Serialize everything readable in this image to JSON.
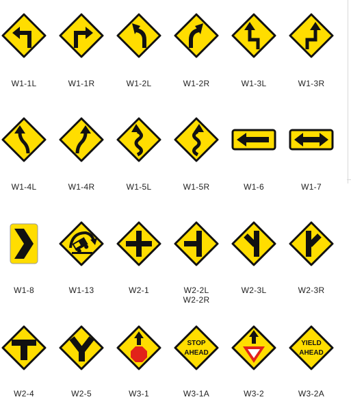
{
  "signs": [
    {
      "code": "W1-1L",
      "icon": "turn-left-icon"
    },
    {
      "code": "W1-1R",
      "icon": "turn-right-icon"
    },
    {
      "code": "W1-2L",
      "icon": "curve-left-icon"
    },
    {
      "code": "W1-2R",
      "icon": "curve-right-icon"
    },
    {
      "code": "W1-3L",
      "icon": "reverse-turn-left-icon"
    },
    {
      "code": "W1-3R",
      "icon": "reverse-turn-right-icon"
    },
    {
      "code": "W1-4L",
      "icon": "reverse-curve-left-icon"
    },
    {
      "code": "W1-4R",
      "icon": "reverse-curve-right-icon"
    },
    {
      "code": "W1-5L",
      "icon": "winding-road-left-icon"
    },
    {
      "code": "W1-5R",
      "icon": "winding-road-right-icon"
    },
    {
      "code": "W1-6",
      "icon": "large-arrow-left-icon"
    },
    {
      "code": "W1-7",
      "icon": "two-direction-arrow-icon"
    },
    {
      "code": "W1-8",
      "icon": "chevron-right-icon"
    },
    {
      "code": "W1-13",
      "icon": "truck-rollover-icon"
    },
    {
      "code": "W2-1",
      "icon": "cross-road-icon"
    },
    {
      "code": "W2-2L",
      "code2": "W2-2R",
      "icon": "side-road-icon"
    },
    {
      "code": "W2-3L",
      "icon": "t-intersection-left-icon"
    },
    {
      "code": "W2-3R",
      "icon": "t-intersection-right-icon"
    },
    {
      "code": "W2-4",
      "icon": "t-intersection-icon"
    },
    {
      "code": "W2-5",
      "icon": "y-intersection-icon"
    },
    {
      "code": "W3-1",
      "icon": "stop-ahead-symbol-icon"
    },
    {
      "code": "W3-1A",
      "icon": "stop-ahead-text-icon",
      "text": [
        "STOP",
        "AHEAD"
      ]
    },
    {
      "code": "W3-2",
      "icon": "yield-ahead-symbol-icon"
    },
    {
      "code": "W3-2A",
      "icon": "yield-ahead-text-icon",
      "text": [
        "YIELD",
        "AHEAD"
      ]
    }
  ],
  "colors": {
    "sign_yellow": "#ffdd00",
    "sign_border": "#111111",
    "stop_red": "#e2231a"
  }
}
